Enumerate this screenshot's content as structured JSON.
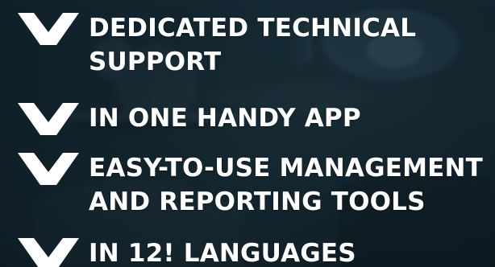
{
  "items": [
    {
      "text": "DEDICATED TECHNICAL\nSUPPORT"
    },
    {
      "text": "IN ONE HANDY APP"
    },
    {
      "text": "EASY-TO-USE MANAGEMENT\nAND REPORTING TOOLS"
    },
    {
      "text": "IN 12! LANGUAGES"
    }
  ],
  "colors": {
    "text": "#ffffff",
    "icon": "#ffffff",
    "background_dark": "#15262f",
    "background_mid": "#1c3442"
  },
  "icon_names": [
    "checkmark-icon",
    "checkmark-icon",
    "checkmark-icon",
    "checkmark-icon"
  ]
}
